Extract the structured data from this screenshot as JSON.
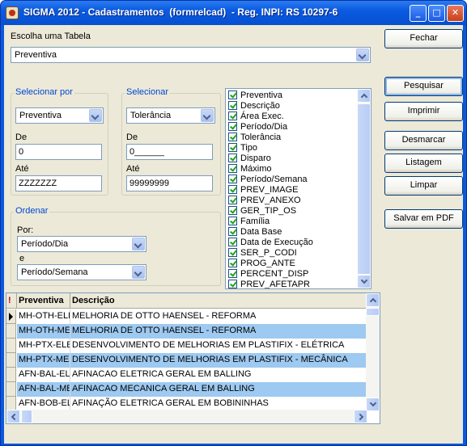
{
  "window": {
    "title": "SIGMA 2012 - Cadastramentos  (formrelcad)  - Reg. INPI: RS 10297-6",
    "min": "_",
    "max": "□",
    "close": "✕"
  },
  "tabela": {
    "label": "Escolha uma Tabela",
    "value": "Preventiva"
  },
  "selecionar_por": {
    "group_label": "Selecionar por",
    "value": "Preventiva",
    "de_label": "De",
    "de_value": "0",
    "ate_label": "Até",
    "ate_value": "ZZZZZZZ"
  },
  "selecionar": {
    "group_label": "Selecionar",
    "value": "Tolerância",
    "de_label": "De",
    "de_value": "0______",
    "ate_label": "Até",
    "ate_value": "99999999"
  },
  "ordenar": {
    "group_label": "Ordenar",
    "por_label": "Por:",
    "por_value": "Período/Dia",
    "e_label": "e",
    "e_value": "Período/Semana"
  },
  "campos": [
    "Preventiva",
    "Descrição",
    "Área Exec.",
    "Período/Dia",
    "Tolerância",
    "Tipo",
    "Disparo",
    "Máximo",
    "Período/Semana",
    "PREV_IMAGE",
    "PREV_ANEXO",
    "GER_TIP_OS",
    "Família",
    "Data Base",
    "Data de Execução",
    "SER_P_CODI",
    "PROG_ANTE",
    "PERCENT_DISP",
    "PREV_AFETAPR"
  ],
  "buttons": {
    "fechar": "Fechar",
    "pesquisar": "Pesquisar",
    "imprimir": "Imprimir",
    "desmarcar": "Desmarcar",
    "listagem": "Listagem",
    "limpar": "Limpar",
    "salvar_pdf": "Salvar em PDF"
  },
  "grid": {
    "flag": "!",
    "columns": [
      "Preventiva",
      "Descrição"
    ],
    "rows": [
      [
        "MH-OTH-ELE",
        "MELHORIA DE OTTO HAENSEL - REFORMA"
      ],
      [
        "MH-OTH-MEC",
        "MELHORIA DE OTTO HAENSEL - REFORMA"
      ],
      [
        "MH-PTX-ELE",
        "DESENVOLVIMENTO DE MELHORIAS EM PLASTIFIX - ELÉTRICA"
      ],
      [
        "MH-PTX-MEC",
        "DESENVOLVIMENTO DE MELHORIAS EM PLASTIFIX - MECÂNICA"
      ],
      [
        "AFN-BAL-ELE",
        "AFINACAO ELETRICA GERAL EM BALLING"
      ],
      [
        "AFN-BAL-MEC",
        "AFINACAO MECANICA GERAL EM BALLING"
      ],
      [
        "AFN-BOB-ELE",
        "AFINAÇÃO ELETRICA GERAL EM BOBININHAS"
      ]
    ]
  }
}
